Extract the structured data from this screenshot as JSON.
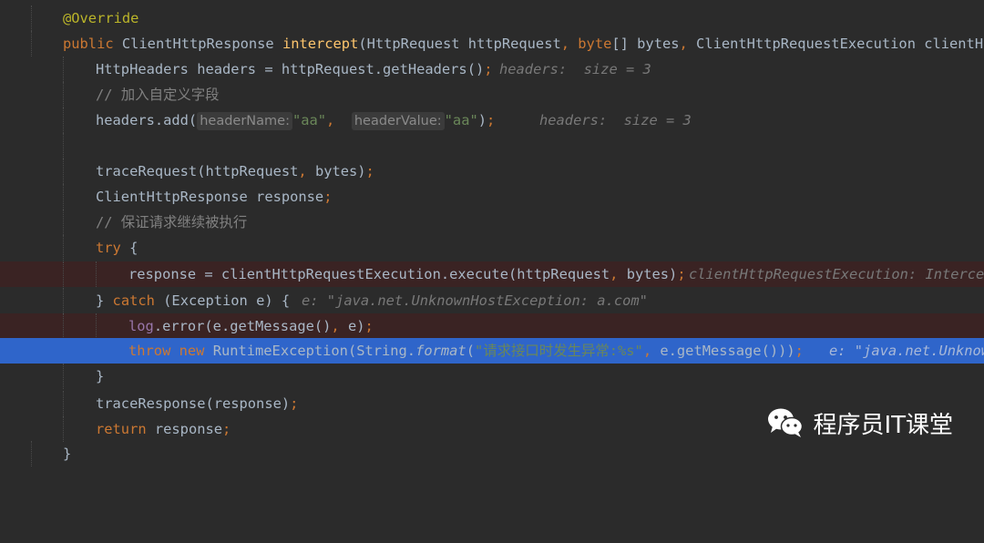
{
  "code": {
    "l1_annotation": "@Override",
    "l2_public": "public ",
    "l2_type": "ClientHttpResponse ",
    "l2_method": "intercept",
    "l2_open": "(HttpRequest httpRequest",
    "l2_comma1": ", ",
    "l2_byte": "byte",
    "l2_bytes": "[] bytes",
    "l2_comma2": ", ",
    "l2_exec": "ClientHttpRequestExecution clientHttp",
    "l3_code": "HttpHeaders headers = httpRequest.getHeaders()",
    "l3_semi": ";",
    "l3_hint": "headers:  size = 3",
    "l4_comment": "// 加入自定义字段",
    "l5_pre": "headers.add(",
    "l5_hint1": "headerName:",
    "l5_str1": "\"aa\"",
    "l5_comma": ", ",
    "l5_hint2": "headerValue:",
    "l5_str2": "\"aa\"",
    "l5_close": ")",
    "l5_semi": ";",
    "l5_hint": "headers:  size = 3",
    "l7_code": "traceRequest(httpRequest",
    "l7_comma": ", ",
    "l7_rest": "bytes)",
    "l7_semi": ";",
    "l8_code": "ClientHttpResponse response",
    "l8_semi": ";",
    "l9_comment": "// 保证请求继续被执行",
    "l10_try": "try",
    "l10_brace": " {",
    "l11_code": "response = clientHttpRequestExecution.execute(httpRequest",
    "l11_comma": ", ",
    "l11_rest": "bytes)",
    "l11_semi": ";",
    "l11_hint": "clientHttpRequestExecution: Intercep",
    "l12_open": "} ",
    "l12_catch": "catch",
    "l12_rest": " (Exception e) {",
    "l12_hint": "e: \"java.net.UnknownHostException: a.com\"",
    "l13_log": "log",
    "l13_rest": ".error(e.getMessage()",
    "l13_comma": ", ",
    "l13_end": "e)",
    "l13_semi": ";",
    "l14_throw": "throw ",
    "l14_new": "new ",
    "l14_type": "RuntimeException(String.",
    "l14_format": "format",
    "l14_open": "(",
    "l14_str": "\"请求接口时发生异常:%s\"",
    "l14_comma": ", ",
    "l14_rest": "e.getMessage()))",
    "l14_semi": ";",
    "l14_hint": "e: \"java.net.Unknow",
    "l15_close": "}",
    "l16_code": "traceResponse(response)",
    "l16_semi": ";",
    "l17_return": "return ",
    "l17_rest": "response",
    "l17_semi": ";",
    "l18_close": "}"
  },
  "watermark": {
    "icon": "wechat-icon",
    "text": "程序员IT课堂"
  },
  "colors": {
    "background": "#2b2b2b",
    "keyword": "#cc7832",
    "annotation": "#bbb529",
    "method": "#ffc66d",
    "string": "#6a8759",
    "comment": "#808080",
    "text": "#a9b7c6",
    "current_line": "#2f65ca",
    "breakpoint_line": "#3a2323"
  }
}
